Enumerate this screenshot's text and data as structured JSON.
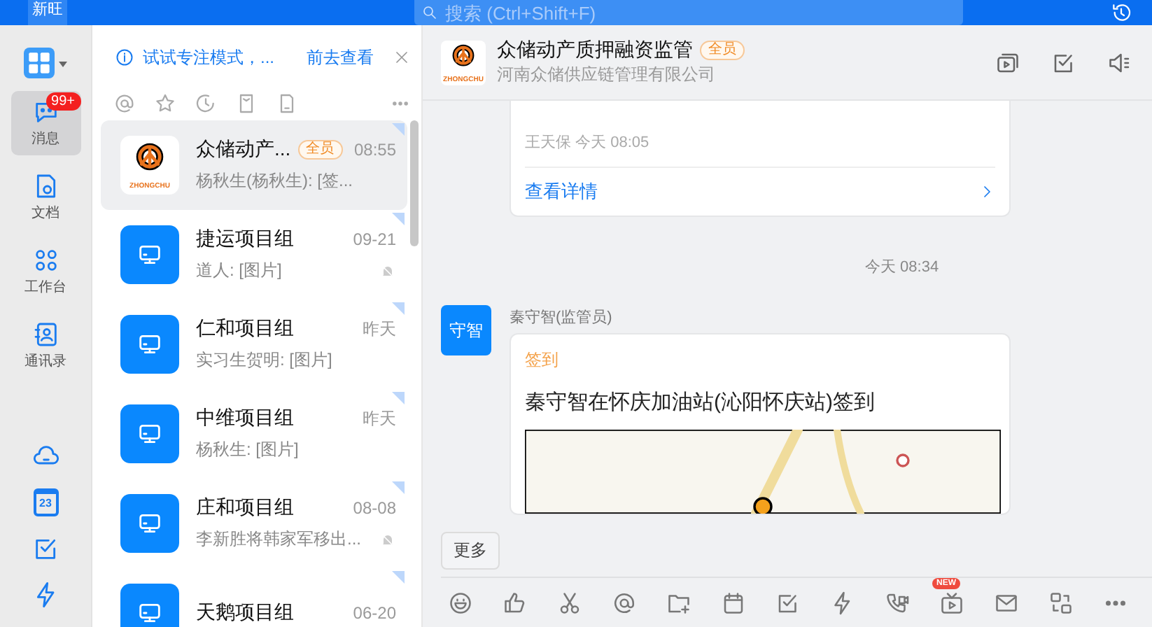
{
  "topbar": {
    "user": "新旺",
    "search_placeholder": "搜索 (Ctrl+Shift+F)"
  },
  "rail": {
    "top": [
      {
        "kind": "chat",
        "label": "消息",
        "badge": "99+",
        "selected": true
      },
      {
        "kind": "doc",
        "label": "文档",
        "selected": false
      },
      {
        "kind": "apps",
        "label": "工作台",
        "selected": false
      },
      {
        "kind": "contacts",
        "label": "通讯录",
        "selected": false
      }
    ],
    "bottom": [
      {
        "kind": "cloud"
      },
      {
        "kind": "calendar",
        "text": "23"
      },
      {
        "kind": "todo"
      },
      {
        "kind": "bolt"
      }
    ]
  },
  "tip": {
    "text": "试试专注模式，...",
    "link": "前去查看"
  },
  "filters": [
    {
      "kind": "at"
    },
    {
      "kind": "star"
    },
    {
      "kind": "clock"
    },
    {
      "kind": "card"
    },
    {
      "kind": "file"
    },
    {
      "kind": "more"
    }
  ],
  "conversations": [
    {
      "kind": "logo",
      "logo_text": "ZHONGCHU",
      "name": "众储动产...",
      "tag": "全员",
      "time": "08:55",
      "preview": "杨秋生(杨秋生): [签...",
      "selected": true,
      "muted": false,
      "pinned": true
    },
    {
      "kind": "group",
      "name": "捷运项目组",
      "time": "09-21",
      "preview": "道人: [图片]",
      "selected": false,
      "muted": true,
      "pinned": true
    },
    {
      "kind": "group",
      "name": "仁和项目组",
      "time": "昨天",
      "preview": "实习生贺明: [图片]",
      "selected": false,
      "muted": false,
      "pinned": true
    },
    {
      "kind": "group",
      "name": "中维项目组",
      "time": "昨天",
      "preview": "杨秋生: [图片]",
      "selected": false,
      "muted": false,
      "pinned": true
    },
    {
      "kind": "group",
      "name": "庄和项目组",
      "time": "08-08",
      "preview": "李新胜将韩家军移出...",
      "selected": false,
      "muted": true,
      "pinned": true
    },
    {
      "kind": "group",
      "name": "天鹅项目组",
      "time": "06-20",
      "selected": false,
      "muted": false,
      "pinned": true
    }
  ],
  "chat": {
    "logo_text": "ZHONGCHU",
    "title": "众储动产质押融资监管",
    "tag": "全员",
    "subtitle": "河南众储供应链管理有限公司",
    "header_actions": [
      {
        "kind": "video"
      },
      {
        "kind": "todo"
      },
      {
        "kind": "speaker"
      }
    ],
    "prev_card": {
      "footer": "王天保 今天 08:05",
      "link": "查看详情"
    },
    "time": "今天 08:34",
    "message": {
      "avatar": "守智",
      "sender": "秦守智(监管员)",
      "card_title": "签到",
      "text": "秦守智在怀庆加油站(沁阳怀庆站)签到"
    },
    "more": "更多",
    "tools": [
      {
        "kind": "emoji"
      },
      {
        "kind": "thumb"
      },
      {
        "kind": "scissors"
      },
      {
        "kind": "at"
      },
      {
        "kind": "folder"
      },
      {
        "kind": "calendar"
      },
      {
        "kind": "todo"
      },
      {
        "kind": "bolt"
      },
      {
        "kind": "call"
      },
      {
        "kind": "live",
        "badge": "NEW"
      },
      {
        "kind": "mail"
      },
      {
        "kind": "swap"
      },
      {
        "kind": "more"
      }
    ]
  }
}
